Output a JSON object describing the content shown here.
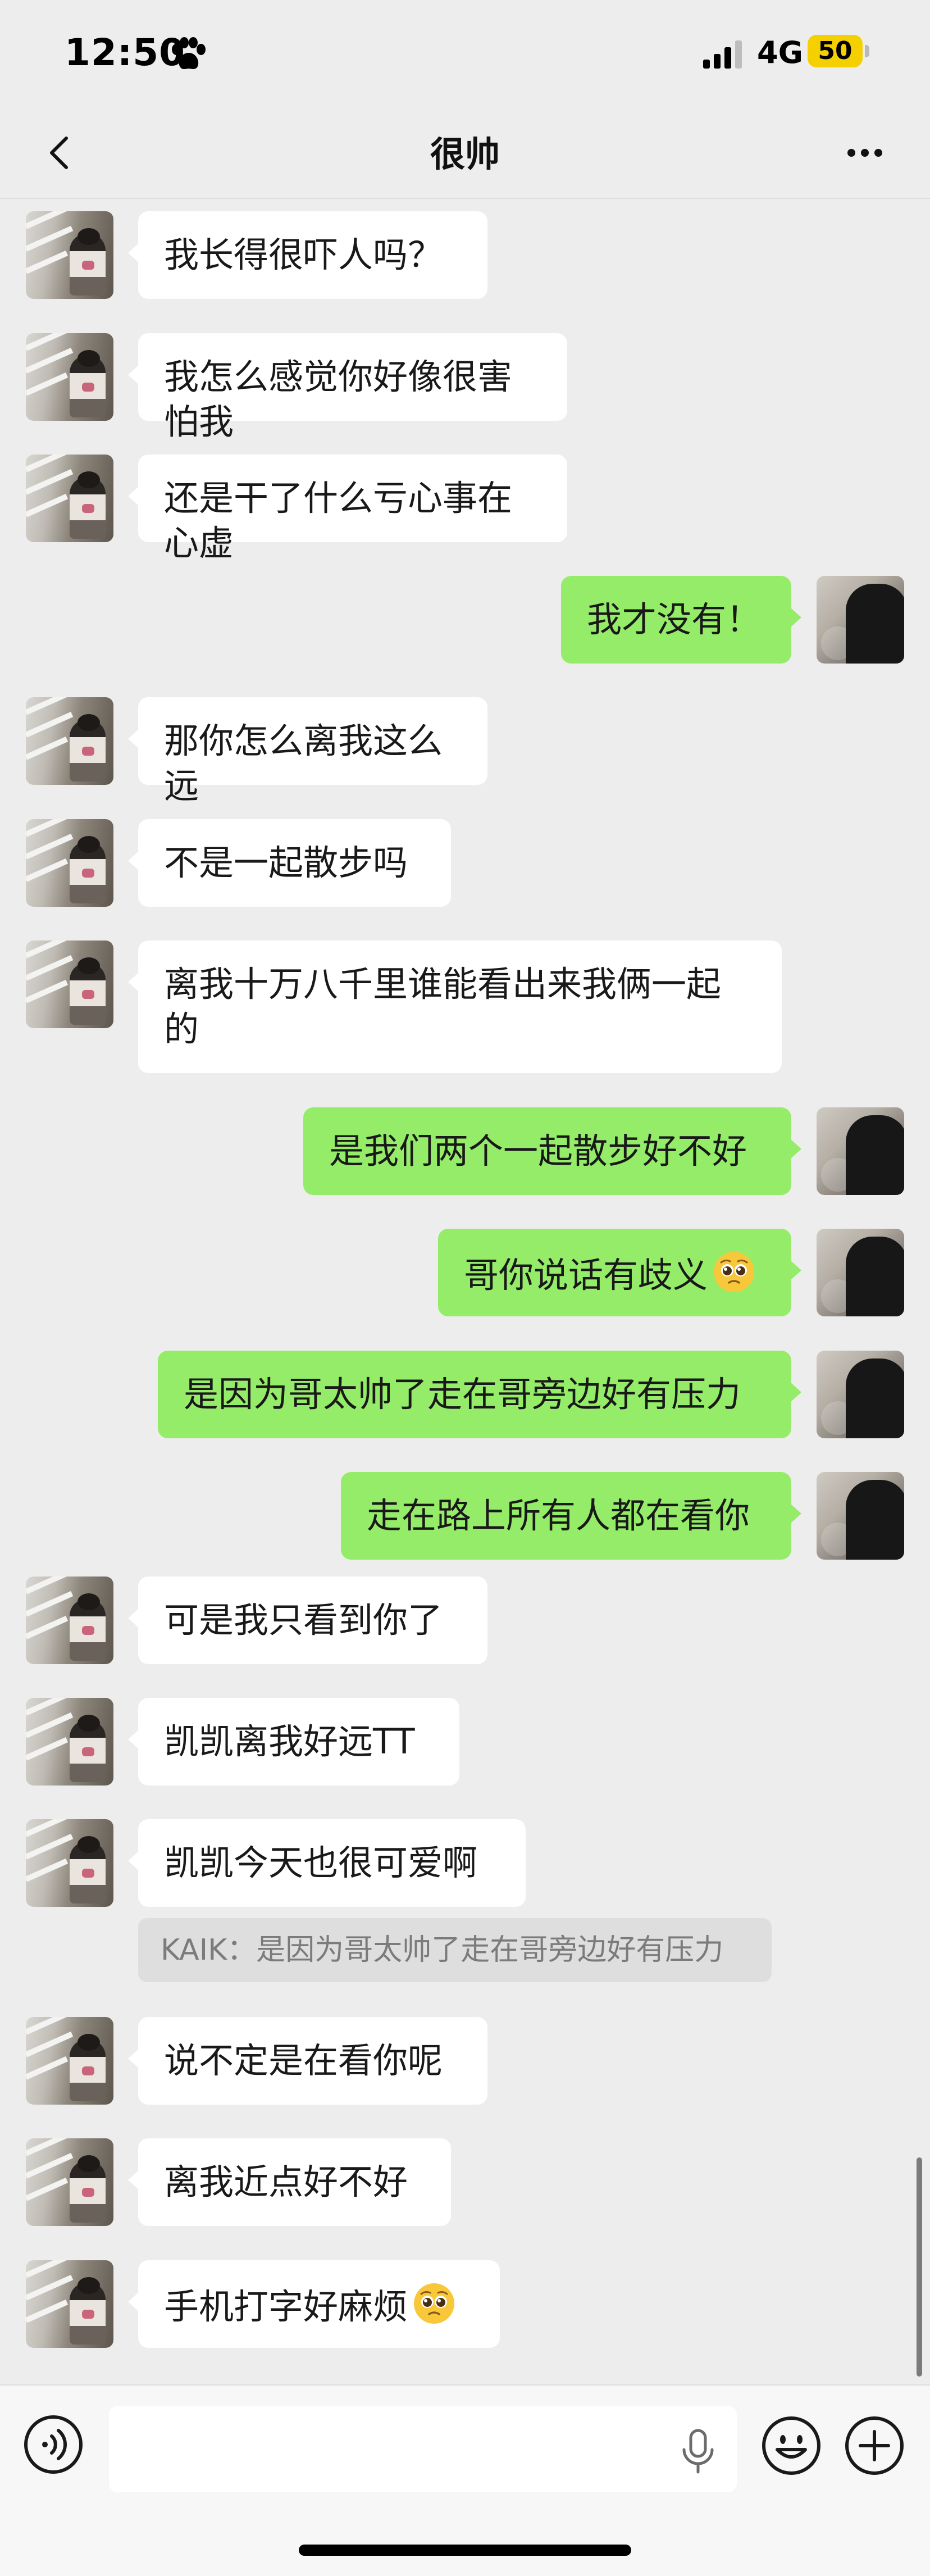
{
  "status_bar": {
    "time": "12:50",
    "network": "4G",
    "battery": "50"
  },
  "nav": {
    "title": "很帅"
  },
  "messages": [
    {
      "side": "left",
      "text": "我长得很吓人吗？"
    },
    {
      "side": "left",
      "text": "我怎么感觉你好像很害怕我"
    },
    {
      "side": "left",
      "text": "还是干了什么亏心事在心虚"
    },
    {
      "side": "right",
      "text": "我才没有！"
    },
    {
      "side": "left",
      "text": "那你怎么离我这么远"
    },
    {
      "side": "left",
      "text": "不是一起散步吗"
    },
    {
      "side": "left",
      "text": "离我十万八千里谁能看出来我俩一起\n的"
    },
    {
      "side": "right",
      "text": "是我们两个一起散步好不好"
    },
    {
      "side": "right",
      "text": "哥你说话有歧义",
      "emoji": "pleading-face"
    },
    {
      "side": "right",
      "text": "是因为哥太帅了走在哥旁边好有压力"
    },
    {
      "side": "right",
      "text": "走在路上所有人都在看你"
    },
    {
      "side": "left",
      "text": "可是我只看到你了"
    },
    {
      "side": "left",
      "text": "凯凯离我好远TT"
    },
    {
      "side": "left",
      "text": "凯凯今天也很可爱啊",
      "quote": "KAIK：是因为哥太帅了走在哥旁边好有压力"
    },
    {
      "side": "left",
      "text": "说不定是在看你呢"
    },
    {
      "side": "left",
      "text": "离我近点好不好"
    },
    {
      "side": "left",
      "text": "手机打字好麻烦",
      "emoji": "pleading-face"
    }
  ],
  "input": {
    "value": "",
    "placeholder": ""
  },
  "colors": {
    "background": "#ededed",
    "bubble_mine": "#95ec69",
    "bubble_other": "#ffffff",
    "battery": "#f5d000"
  },
  "icons": {
    "status": [
      "paw-icon",
      "signal-icon"
    ],
    "nav": [
      "back-icon",
      "more-icon"
    ],
    "input": [
      "voice-icon",
      "mic-icon",
      "emoji-icon",
      "add-icon"
    ]
  }
}
